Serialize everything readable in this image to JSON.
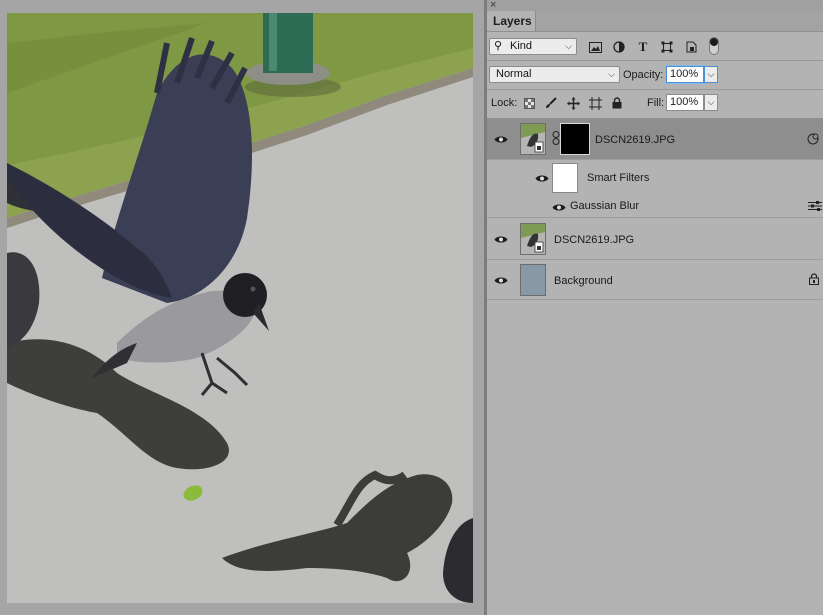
{
  "panel": {
    "close_glyph": "×",
    "tab_label": "Layers",
    "menu_glyph": "≡"
  },
  "filter": {
    "kind_label": "Kind",
    "icons": [
      "pixel-layer-filter-icon",
      "adjustment-layer-filter-icon",
      "type-layer-filter-icon",
      "shape-layer-filter-icon",
      "smart-object-filter-icon"
    ]
  },
  "blend": {
    "mode": "Normal",
    "opacity_label": "Opacity:",
    "opacity_value": "100%"
  },
  "lock": {
    "label": "Lock:",
    "icons": [
      "lock-transparent-pixels-icon",
      "lock-image-pixels-icon",
      "lock-position-icon",
      "lock-artboard-icon",
      "lock-all-icon"
    ],
    "fill_label": "Fill:",
    "fill_value": "100%"
  },
  "layers": {
    "smart_layer_name": "DSCN2619.JPG",
    "smart_filters_label": "Smart Filters",
    "filter_name": "Gaussian Blur",
    "copy_layer_name": "DSCN2619.JPG",
    "background_name": "Background"
  },
  "colors": {
    "selected_row": "#8e8e8e",
    "panel_bg": "#b3b3b3",
    "focus_blue": "#4a8fd8",
    "background_thumb": "#8898a4"
  }
}
